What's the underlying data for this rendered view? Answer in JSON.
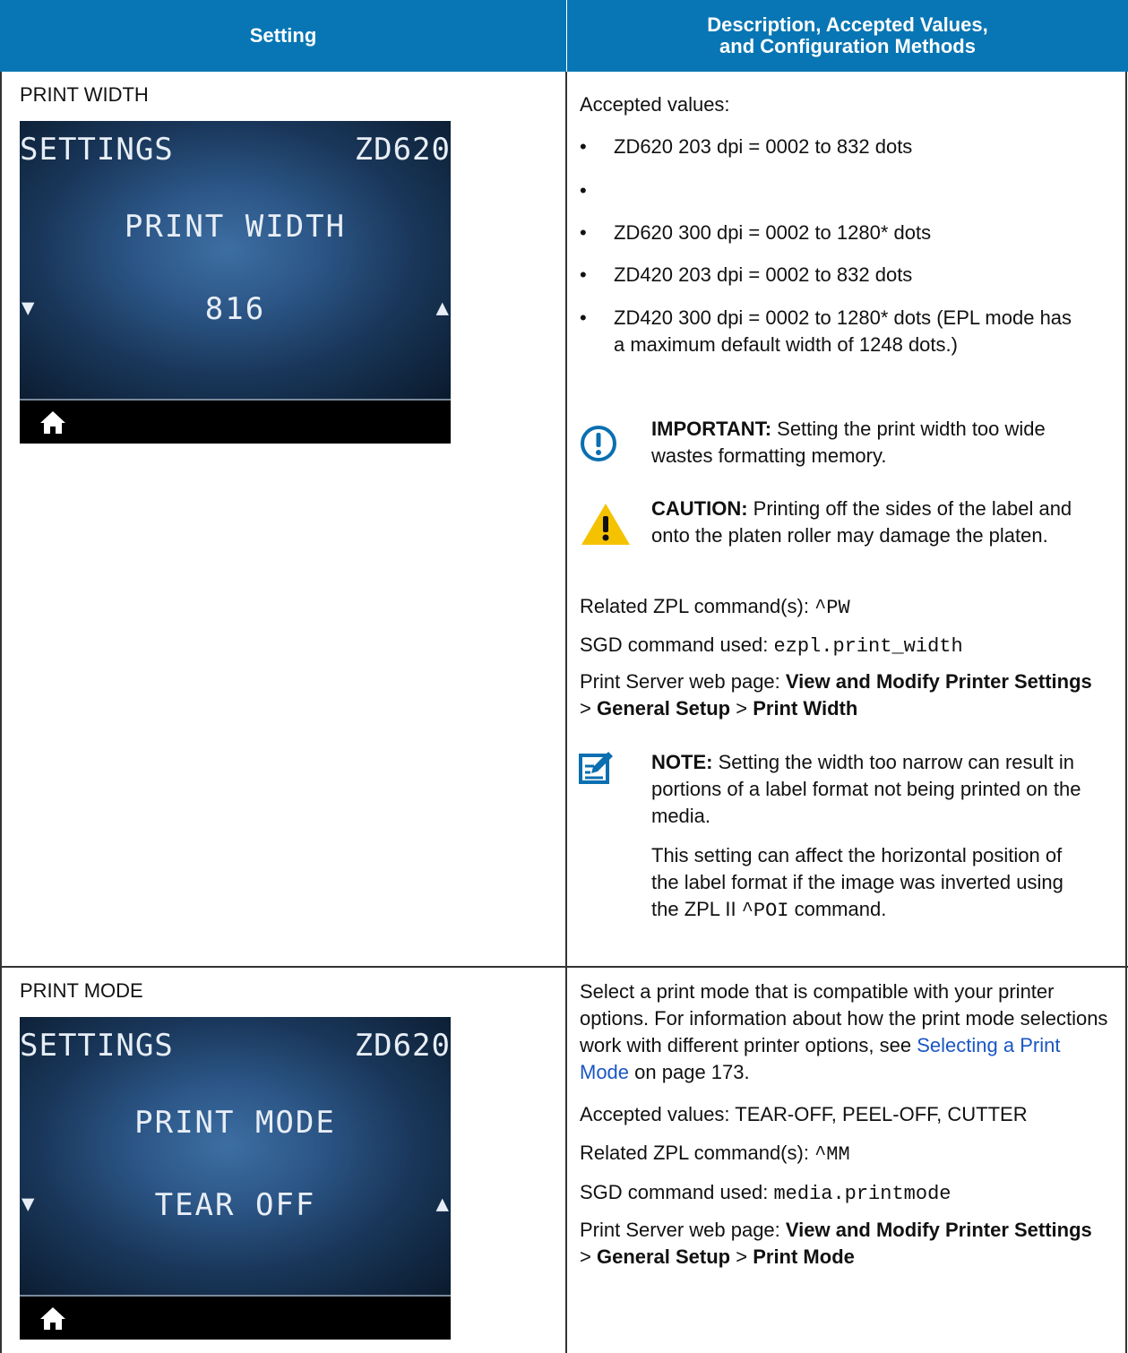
{
  "table": {
    "headers": [
      "Setting",
      "Description, Accepted Values,",
      "and Configuration Methods"
    ]
  },
  "row1": {
    "setting": "PRINT WIDTH",
    "lcd": {
      "left": "SETTINGS",
      "right": "ZD620",
      "title": "PRINT WIDTH",
      "value": "816"
    },
    "accepted_label": "Accepted values:",
    "bullets": [
      "ZD620 203 dpi = 0002 to 832 dots",
      "",
      "ZD620 300 dpi = 0002 to 1280* dots",
      "ZD420 203 dpi = 0002 to 832 dots",
      "ZD420 300 dpi = 0002 to 1280* dots (EPL mode has a maximum default width of 1248 dots.)"
    ],
    "important": {
      "label": "IMPORTANT:",
      "text": " Setting the print width too wide wastes formatting memory."
    },
    "caution": {
      "label": "CAUTION:",
      "text": " Printing off the sides of the label and onto the platen roller may damage the platen."
    },
    "zpl": {
      "label": "Related ZPL command(s): ",
      "value": "^PW"
    },
    "sgd": {
      "label": "SGD command used: ",
      "value": "ezpl.print_width"
    },
    "web": {
      "label": "Print Server web page: ",
      "p1": "View and Modify Printer Settings",
      "sep1": " > ",
      "p2": "General Setup",
      "sep2": " > ",
      "p3": "Print Width"
    },
    "note": {
      "label": "NOTE:",
      "text": " Setting the width too narrow can result in portions of a label format not being printed on the media.",
      "text2a": "This setting can affect the horizontal position of the label format if the image was inverted using the ZPL II ",
      "text2code": "^POI",
      "text2b": " command."
    }
  },
  "row2": {
    "setting": "PRINT MODE",
    "lcd": {
      "left": "SETTINGS",
      "right": "ZD620",
      "title": "PRINT MODE",
      "value": "TEAR OFF"
    },
    "intro_a": "Select a print mode that is compatible with your printer options. For information about how the print mode selections work with different printer options, see ",
    "intro_link": "Selecting a Print Mode",
    "intro_b": " on page 173.",
    "accepted": "Accepted values: TEAR-OFF, PEEL-OFF, CUTTER",
    "zpl": {
      "label": "Related ZPL command(s): ",
      "value": "^MM"
    },
    "sgd": {
      "label": "SGD command used: ",
      "value": "media.printmode"
    },
    "web": {
      "label": "Print Server web page: ",
      "p1": "View and Modify Printer Settings",
      "sep1": " > ",
      "p2": "General Setup",
      "sep2": " > ",
      "p3": "Print Mode"
    }
  },
  "colors": {
    "header": "#0876b4",
    "link": "#1a56c4",
    "important": "#0a6fb0",
    "caution": "#f5c200",
    "note": "#0a6fb0"
  }
}
